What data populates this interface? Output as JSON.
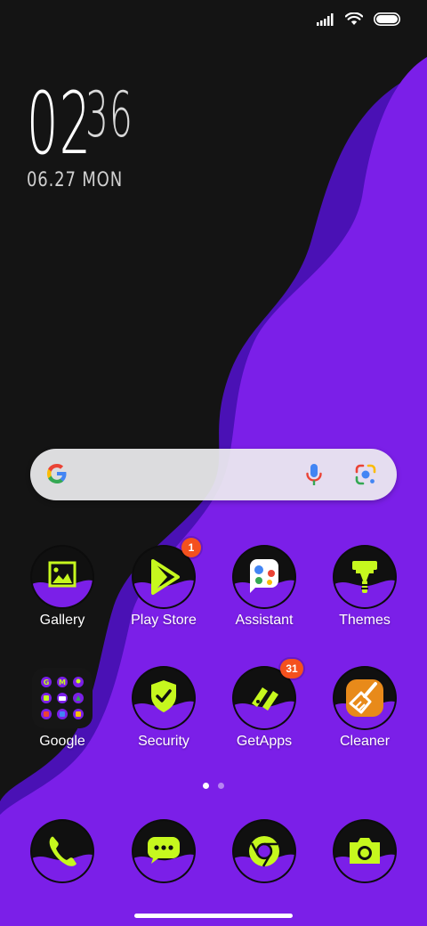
{
  "colors": {
    "background": "#141414",
    "wave_purple": "#7b1fe8",
    "wave_dark": "#4a11b5",
    "icon_accent": "#c6f81e",
    "badge": "#f4511e"
  },
  "status_bar": {
    "icons": [
      "signal-icon",
      "wifi-icon",
      "battery-icon"
    ]
  },
  "clock": {
    "hour": "02",
    "minute": "36",
    "date": "06.27 MON"
  },
  "search": {
    "icons": [
      "google-logo-icon",
      "microphone-icon",
      "lens-icon"
    ]
  },
  "apps": {
    "gallery": {
      "label": "Gallery",
      "icon": "image-icon"
    },
    "play_store": {
      "label": "Play Store",
      "icon": "play-icon",
      "badge": "1"
    },
    "assistant": {
      "label": "Assistant",
      "icon": "assistant-icon"
    },
    "themes": {
      "label": "Themes",
      "icon": "paint-roller-icon"
    },
    "google": {
      "label": "Google",
      "icon": "folder-icon"
    },
    "security": {
      "label": "Security",
      "icon": "shield-check-icon"
    },
    "getapps": {
      "label": "GetApps",
      "icon": "getapps-icon",
      "badge": "31"
    },
    "cleaner": {
      "label": "Cleaner",
      "icon": "broom-icon"
    }
  },
  "dock": [
    "phone-icon",
    "messages-icon",
    "chrome-icon",
    "camera-icon"
  ],
  "pages": {
    "current": 1,
    "total": 2
  }
}
